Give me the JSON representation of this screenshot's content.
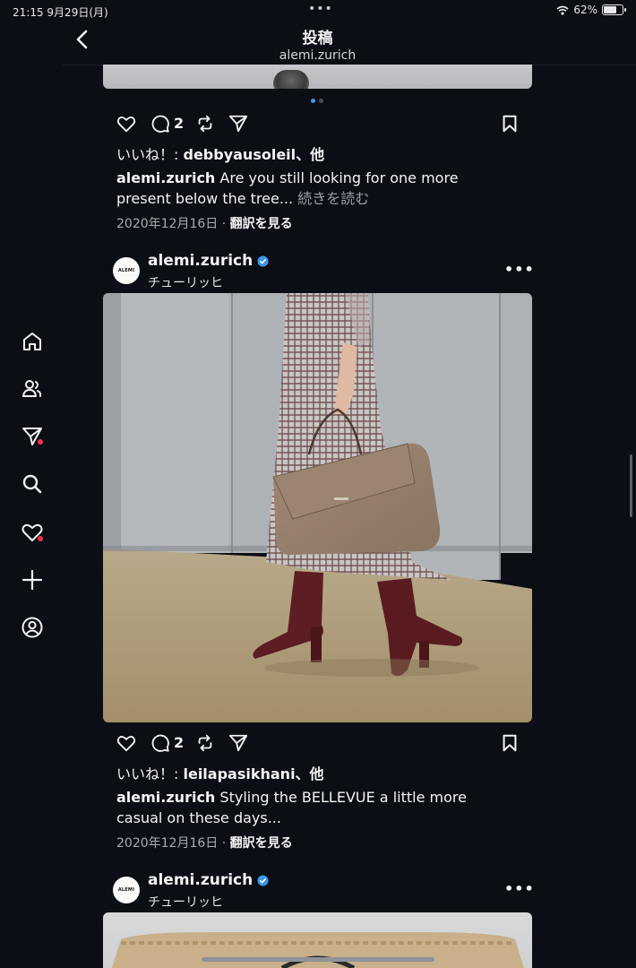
{
  "status_bar": {
    "time": "21:15",
    "date": "9月29日(月)",
    "dots": "•••",
    "battery": "62%",
    "battery_level": 0.62
  },
  "header": {
    "title": "投稿",
    "subtitle": "alemi.zurich"
  },
  "sidebar": [
    "home-icon",
    "reels-icon",
    "messages-icon",
    "search-icon",
    "notifications-icon",
    "create-icon",
    "profile-icon"
  ],
  "post1": {
    "comment_count": "2",
    "likes_prefix": "いいね！: ",
    "likes_user": "debbyausoleil",
    "likes_suffix": "、他",
    "caption_user": "alemi.zurich",
    "caption_text": " Are you still looking for one more present below the tree... ",
    "more": "続きを読む",
    "date": "2020年12月16日",
    "separator": " · ",
    "translate": "翻訳を見る"
  },
  "post2": {
    "avatar_text": "ALEMI",
    "username": "alemi.zurich",
    "location": "チューリッヒ",
    "options": "•••",
    "comment_count": "2",
    "likes_prefix": "いいね！: ",
    "likes_user": "leilapasikhani",
    "likes_suffix": "、他",
    "caption_user": "alemi.zurich",
    "caption_text": " Styling the BELLEVUE a little more casual on these days...",
    "date": "2020年12月16日",
    "separator": " · ",
    "translate": "翻訳を見る"
  },
  "post3": {
    "avatar_text": "ALEMI",
    "username": "alemi.zurich",
    "location": "チューリッヒ",
    "options": "•••"
  },
  "colors": {
    "background": "#0b0e14",
    "accent": "#3897f0",
    "badge": "#ff3040"
  }
}
